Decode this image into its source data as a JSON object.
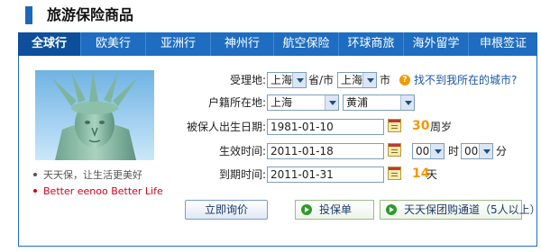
{
  "header": {
    "title": "旅游保险商品"
  },
  "tabs": [
    {
      "label": "全球行",
      "active": true
    },
    {
      "label": "欧美行"
    },
    {
      "label": "亚洲行"
    },
    {
      "label": "神州行"
    },
    {
      "label": "航空保险"
    },
    {
      "label": "环球商旅"
    },
    {
      "label": "海外留学"
    },
    {
      "label": "申根签证"
    }
  ],
  "sidebar": {
    "slogans": [
      "天天保，让生活更美好",
      "Better eenoo Better Life"
    ]
  },
  "form": {
    "accept_label": "受理地:",
    "province_value": "上海",
    "province_unit": "省/市",
    "city_value": "上海",
    "city_unit": "市",
    "help_link": "找不到我所在的城市?",
    "hukou_label": "户籍所在地:",
    "hukou_province": "上海",
    "hukou_district": "黄浦",
    "birth_label": "被保人出生日期:",
    "birth_value": "1981-01-10",
    "age_value": "30",
    "age_unit": "周岁",
    "effective_label": "生效时间:",
    "effective_value": "2011-01-18",
    "hour_value": "00",
    "hour_unit": "时",
    "minute_value": "00",
    "minute_unit": "分",
    "expire_label": "到期时间:",
    "expire_value": "2011-01-31",
    "days_value": "14",
    "days_unit": "天"
  },
  "actions": {
    "quote": "立即询价",
    "apply": "投保单",
    "group": "天天保团购通道（5人以上）"
  },
  "colors": {
    "accent": "#1e6dc1",
    "highlight": "#f39800",
    "red": "#d0021b"
  }
}
